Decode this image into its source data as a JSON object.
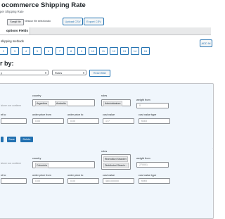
{
  "header": {
    "title": "ocommerce Shipping Rate",
    "subtitle": "per Shipping Rate",
    "choose_file": "Scegli file",
    "file_status": "Nessun file selezionato",
    "upload_csv": "Upload CSV",
    "export_csv": "Export CSV"
  },
  "tabs": {
    "active": "options Fields"
  },
  "shipping_methods": {
    "label": "shipping methods",
    "add_button": "ADD M",
    "numbers": [
      "2",
      "3",
      "4",
      "5",
      "6",
      "7",
      "8",
      "9",
      "10",
      "11",
      "12",
      "13",
      "14",
      "15"
    ]
  },
  "filter": {
    "title": "r by:",
    "select1": "y",
    "select2": "Roles",
    "reset": "Reset filter"
  },
  "rule1": {
    "country_label": "country",
    "country_chips": [
      "Argentina",
      "Australia"
    ],
    "roles_label": "roles",
    "roles_chips": [
      "Administratore"
    ],
    "weight_from_label": "weight from",
    "weight_from_value": "0",
    "placeholder_left": "izione con contiene",
    "to_label": "nt to",
    "order_price_from_label": "order price from",
    "order_price_from_value": "0.00",
    "order_price_to_label": "order price to",
    "order_price_to_value": "0.00",
    "cost_value_label": "cost value",
    "cost_value_value": "177",
    "cost_value_type_label": "cost value type",
    "cost_value_type_value": "fixed",
    "save_label": "Save",
    "delete_label": "Delete"
  },
  "rule2": {
    "country_label": "country",
    "country_chips": [
      "Colombia"
    ],
    "roles_label": "roles",
    "roles_chips": [
      "Rivenditori Stranieri",
      "Distributori Stranie..."
    ],
    "weight_from_label": "weight from",
    "weight_from_value": "270001",
    "placeholder_left": "izione con contiene",
    "to_label": "nt to",
    "order_price_from_label": "order price from",
    "order_price_from_value": "0.00",
    "order_price_to_label": "order price to",
    "order_price_to_value": "0.00",
    "cost_value_label": "cost value",
    "cost_value_value": "480.000000",
    "cost_value_type_label": "cost value type",
    "cost_value_type_value": "fixed"
  }
}
